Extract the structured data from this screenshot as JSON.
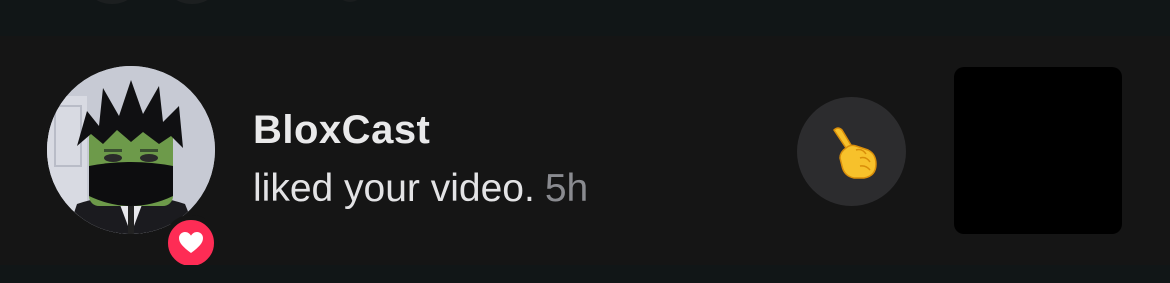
{
  "notification": {
    "username": "BloxCast",
    "action_text": "liked your video.",
    "time": "5h",
    "type_badge": "heart-icon",
    "reaction_icon": "pointing-hand-icon"
  },
  "colors": {
    "background": "#111617",
    "row_background": "#151515",
    "badge": "#fe2c55",
    "reaction_button": "#2c2c2e",
    "thumbnail": "#000000",
    "username_text": "#e9e9ea",
    "time_text": "#8a8b90"
  }
}
